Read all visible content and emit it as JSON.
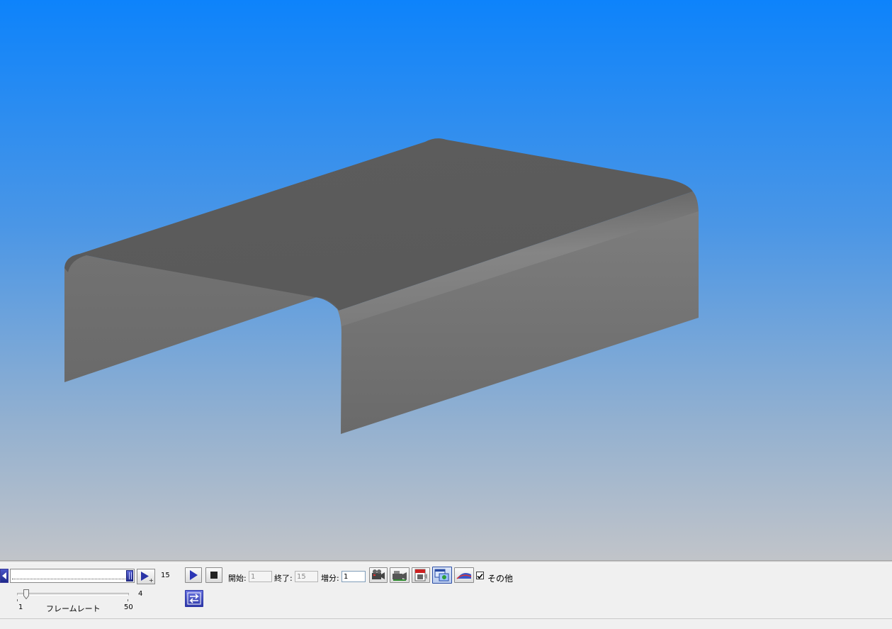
{
  "viewport": {
    "gradient_top": "#0d83fb",
    "gradient_bottom": "#c1c4c9",
    "model_color": "#6e6e6e"
  },
  "timeline": {
    "current_frame": "15",
    "position_fraction": 1.0
  },
  "playback": {
    "play_icon": "play-icon",
    "stop_icon": "stop-icon"
  },
  "range": {
    "start_label": "開始:",
    "start_value": "1",
    "end_label": "終了:",
    "end_value": "15",
    "step_label": "増分:",
    "step_value": "1"
  },
  "tools": {
    "icons": [
      "camera-record-icon",
      "video-camera-icon",
      "avi-export-icon",
      "window-capture-icon",
      "surface-display-icon"
    ]
  },
  "other": {
    "checked": true,
    "label": "その他"
  },
  "framerate": {
    "min": "1",
    "max": "50",
    "value": "4",
    "label": "フレームレート",
    "slider_fraction": 0.06
  },
  "swap": {
    "icon": "swap-arrows-icon"
  }
}
